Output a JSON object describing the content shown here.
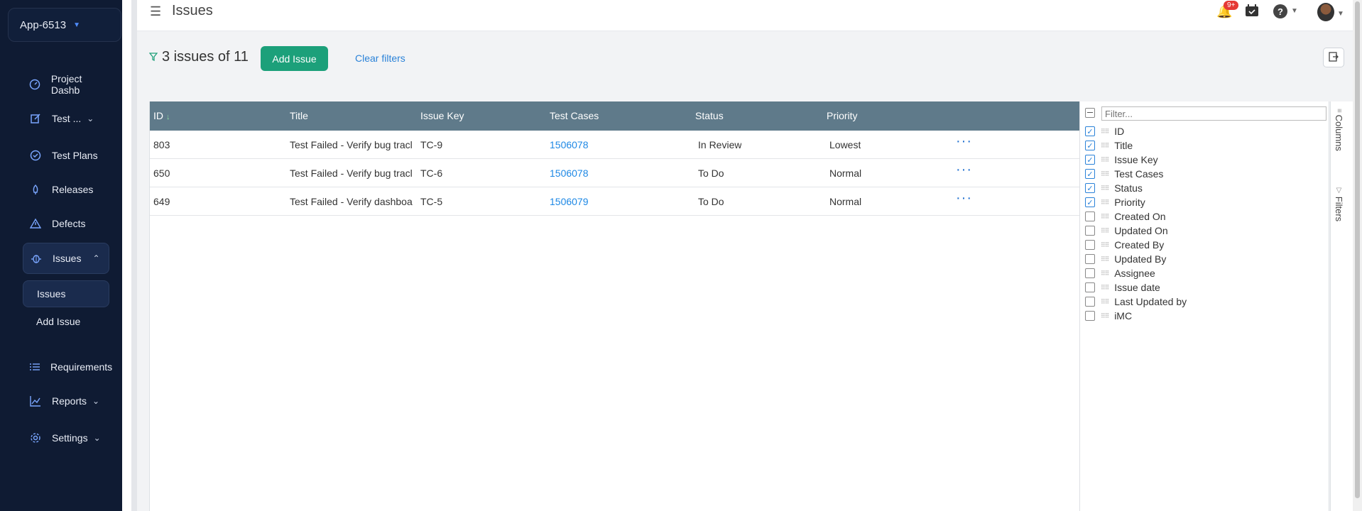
{
  "app": {
    "name": "App-6513"
  },
  "sidebar": {
    "items": [
      {
        "label": "Project Dashb",
        "icon": "dashboard-icon"
      },
      {
        "label": "Test ...",
        "icon": "edit-icon"
      },
      {
        "label": "Test Plans",
        "icon": "check-circle-icon"
      },
      {
        "label": "Releases",
        "icon": "rocket-icon"
      },
      {
        "label": "Defects",
        "icon": "warning-icon"
      },
      {
        "label": "Issues",
        "icon": "bug-icon"
      },
      {
        "label": "Requirements",
        "icon": "list-icon"
      },
      {
        "label": "Reports",
        "icon": "chart-icon"
      },
      {
        "label": "Settings",
        "icon": "gear-icon"
      }
    ],
    "subitems": [
      {
        "label": "Issues"
      },
      {
        "label": "Add Issue"
      }
    ]
  },
  "header": {
    "title": "Issues",
    "notification_badge": "9+",
    "help_label": "?"
  },
  "toolbar": {
    "count_text": "3 issues of 11",
    "add_label": "Add Issue",
    "clear_label": "Clear filters"
  },
  "table": {
    "columns": [
      "ID",
      "Title",
      "Issue Key",
      "Test Cases",
      "Status",
      "Priority"
    ],
    "rows": [
      {
        "id": "803",
        "title": "Test Failed - Verify bug tracl",
        "key": "TC-9",
        "test_case": "1506078",
        "status": "In Review",
        "priority": "Lowest",
        "more": "···"
      },
      {
        "id": "650",
        "title": "Test Failed - Verify bug tracl",
        "key": "TC-6",
        "test_case": "1506078",
        "status": "To Do",
        "priority": "Normal",
        "more": "···"
      },
      {
        "id": "649",
        "title": "Test Failed - Verify dashboa",
        "key": "TC-5",
        "test_case": "1506079",
        "status": "To Do",
        "priority": "Normal",
        "more": "···"
      }
    ]
  },
  "column_panel": {
    "filter_placeholder": "Filter...",
    "columns": [
      {
        "label": "ID",
        "checked": true
      },
      {
        "label": "Title",
        "checked": true
      },
      {
        "label": "Issue Key",
        "checked": true
      },
      {
        "label": "Test Cases",
        "checked": true
      },
      {
        "label": "Status",
        "checked": true
      },
      {
        "label": "Priority",
        "checked": true
      },
      {
        "label": "Created On",
        "checked": false
      },
      {
        "label": "Updated On",
        "checked": false
      },
      {
        "label": "Created By",
        "checked": false
      },
      {
        "label": "Updated By",
        "checked": false
      },
      {
        "label": "Assignee",
        "checked": false
      },
      {
        "label": "Issue date",
        "checked": false
      },
      {
        "label": "Last Updated by",
        "checked": false
      },
      {
        "label": "iMC",
        "checked": false
      }
    ],
    "tabs": [
      "Columns",
      "Filters"
    ]
  },
  "colors": {
    "sidebar_bg": "#0f1b33",
    "accent": "#1ca07a",
    "header_bg": "#5f7a8a",
    "link": "#1e88e5"
  }
}
